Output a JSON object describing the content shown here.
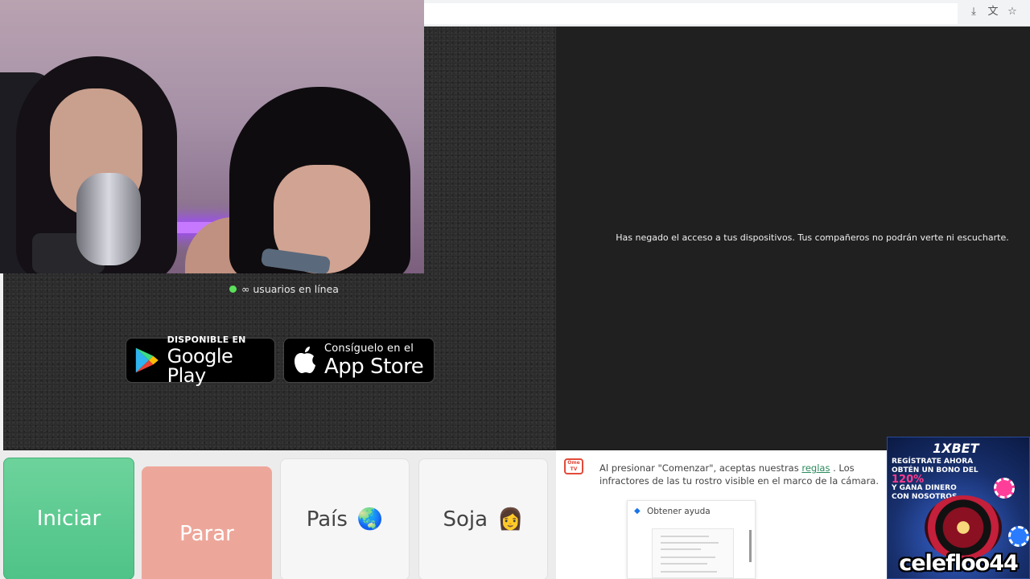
{
  "online": {
    "count_text": "∞ usuarios en línea"
  },
  "badges": {
    "google_play": {
      "small": "DISPONIBLE EN",
      "big": "Google Play"
    },
    "app_store": {
      "small": "Consíguelo en el",
      "big": "App Store"
    }
  },
  "remote": {
    "message": "Has negado el acceso a tus dispositivos. Tus compañeros no podrán verte ni escucharte."
  },
  "controls": {
    "start_label": "Iniciar",
    "stop_label": "Parar",
    "country_label": "País",
    "country_emoji": "🌏",
    "gender_label": "Soja",
    "gender_emoji": "👩"
  },
  "chat": {
    "logo_text": "Ome TV",
    "rules_before": "Al presionar \"Comenzar\", aceptas nuestras ",
    "rules_link": "reglas",
    "rules_after": " . Los infractores de las tu rostro visible en el marco de la cámara."
  },
  "help": {
    "title": "Obtener ayuda"
  },
  "ad": {
    "brand": "1XBET",
    "line1": "REGÍSTRATE AHORA",
    "line2": "OBTÉN UN BONO DEL",
    "pct": "120%",
    "line3": "Y GANA DINERO",
    "line4": "CON NOSOTROS",
    "streamer": "celefloo44"
  },
  "browser": {
    "icons": [
      "install-icon",
      "translate-icon",
      "bookmark-star-icon"
    ]
  },
  "colors": {
    "start": "#4fc388",
    "stop": "#eda79a",
    "online_dot": "#5ce05c",
    "link": "#2a8a5c"
  }
}
